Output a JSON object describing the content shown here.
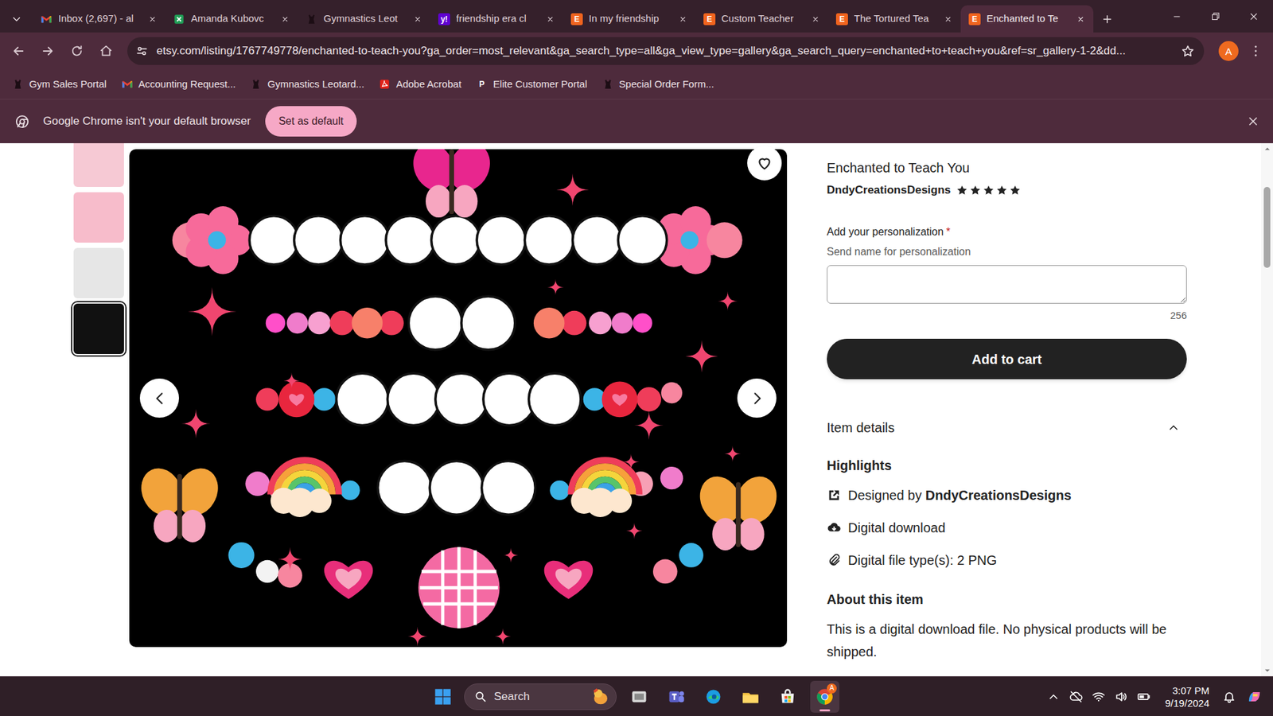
{
  "tabs": [
    {
      "label": "Inbox (2,697) - al",
      "kind": "gmail",
      "selected": false
    },
    {
      "label": "Amanda Kubovc",
      "kind": "sheets",
      "selected": false
    },
    {
      "label": "Gymnastics Leot",
      "kind": "leotard",
      "selected": false
    },
    {
      "label": "friendship era cl",
      "kind": "yahoo",
      "glyph": "y!",
      "selected": false
    },
    {
      "label": "In my friendship",
      "kind": "etsy",
      "glyph": "E",
      "selected": false
    },
    {
      "label": "Custom Teacher",
      "kind": "etsy",
      "glyph": "E",
      "selected": false
    },
    {
      "label": "The Tortured Tea",
      "kind": "etsy",
      "glyph": "E",
      "selected": false
    },
    {
      "label": "Enchanted to Te",
      "kind": "etsy",
      "glyph": "E",
      "selected": true
    }
  ],
  "address_bar": {
    "url": "etsy.com/listing/1767749778/enchanted-to-teach-you?ga_order=most_relevant&ga_search_type=all&ga_view_type=gallery&ga_search_query=enchanted+to+teach+you&ref=sr_gallery-1-2&dd...",
    "profile": "A"
  },
  "bookmarks": [
    {
      "label": "Gym Sales Portal",
      "kind": "leotard"
    },
    {
      "label": "Accounting Request...",
      "kind": "gmail"
    },
    {
      "label": "Gymnastics Leotard...",
      "kind": "leotard"
    },
    {
      "label": "Adobe Acrobat",
      "kind": "acrobat"
    },
    {
      "label": "Elite Customer Portal",
      "kind": "letter",
      "glyph": "P"
    },
    {
      "label": "Special Order Form...",
      "kind": "leotard"
    }
  ],
  "infobar": {
    "message": "Google Chrome isn't your default browser",
    "button": "Set as default"
  },
  "gallery": {
    "thumbnails": [
      {
        "color": "#f6c9d4",
        "selected": false
      },
      {
        "color": "#f7bccb",
        "selected": false
      },
      {
        "color": "#e6e6e6",
        "selected": false
      },
      {
        "color": "#111111",
        "selected": true
      }
    ],
    "favorited": false
  },
  "product": {
    "title": "Enchanted to Teach You",
    "shop": "DndyCreationsDesigns",
    "stars": 5,
    "personalization": {
      "label": "Add your personalization",
      "required": "*",
      "hint": "Send name for personalization",
      "value": "",
      "counter": "256"
    },
    "add_to_cart": "Add to cart",
    "details": {
      "title": "Item details",
      "expanded": true,
      "highlights_title": "Highlights",
      "highlights": [
        {
          "kind": "designer",
          "prefix": "Designed by ",
          "strong": "DndyCreationsDesigns"
        },
        {
          "kind": "download",
          "text": "Digital download"
        },
        {
          "kind": "file",
          "text": "Digital file type(s): 2 PNG"
        }
      ],
      "about_title": "About this item",
      "about_text": "This is a digital download file. No physical products will be shipped."
    }
  },
  "taskbar": {
    "search": "Search",
    "apps": [
      {
        "kind": "taskview",
        "active": false
      },
      {
        "kind": "teams",
        "active": false
      },
      {
        "kind": "edge",
        "active": false
      },
      {
        "kind": "explorer",
        "active": false
      },
      {
        "kind": "store",
        "active": false
      },
      {
        "kind": "chrome",
        "active": true,
        "badge": "A"
      }
    ],
    "time": "3:07 PM",
    "date": "9/19/2024"
  }
}
